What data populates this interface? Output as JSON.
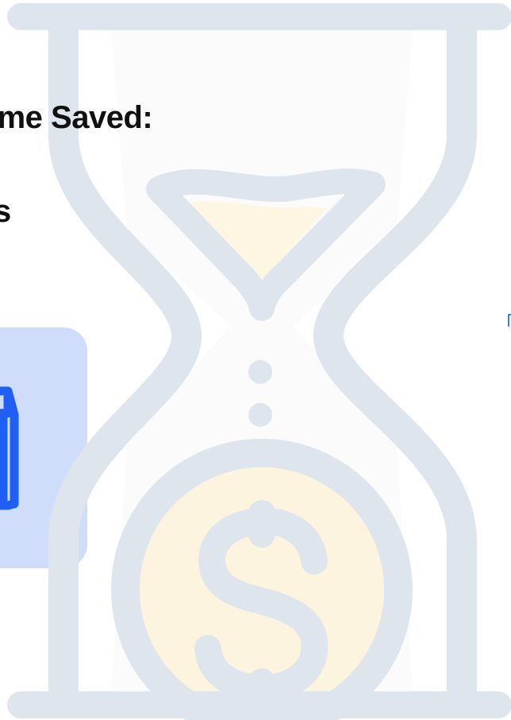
{
  "headline": {
    "line1": "ime Saved:",
    "line2": "s"
  },
  "colors": {
    "hourglass_outline": "#dfe5ec",
    "sand_fill": "#fdf6e3",
    "coin_fill": "#fdf4df",
    "panel_fill": "#ccdafa",
    "panel_icon": "#1f5ff5",
    "text": "#111111",
    "accent": "#3f7ee8"
  },
  "icons": [
    "hourglass-icon",
    "dollar-coin-icon",
    "document-icon"
  ]
}
